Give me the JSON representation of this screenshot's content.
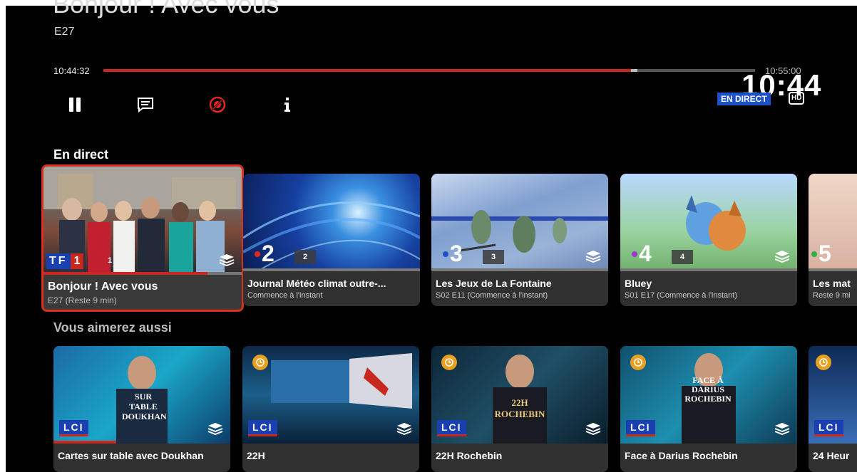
{
  "player": {
    "title": "Bonjour ! Avec vous",
    "episode": "E27",
    "time_start": "10:44:32",
    "time_end": "10:55:00",
    "progress": 0.81,
    "buffered": 0.82,
    "clock": "10:44",
    "live_label": "EN DIRECT",
    "hd_label": "HD",
    "controls": [
      "pause",
      "subtitles",
      "stop-record",
      "info"
    ]
  },
  "sections": {
    "live_title": "En direct",
    "suggest_title": "Vous aimerez aussi"
  },
  "live_cards": [
    {
      "title": "Bonjour ! Avec vous",
      "sub": "E27 (Reste 9 min)",
      "channel": "1",
      "logo": "TF1"
    },
    {
      "title": "Journal Météo climat outre-...",
      "sub": "Commence à l'instant",
      "channel": "2",
      "logo": "2"
    },
    {
      "title": "Les Jeux de La Fontaine",
      "sub": "S02 E11 (Commence à l'instant)",
      "channel": "3",
      "logo": "3"
    },
    {
      "title": "Bluey",
      "sub": "S01 E17 (Commence à l'instant)",
      "channel": "4",
      "logo": "4"
    },
    {
      "title": "Les mat",
      "sub": "Reste 9 mi",
      "channel": "5",
      "logo": "5"
    }
  ],
  "suggest_cards": [
    {
      "title": "Cartes sur table avec Doukhan",
      "logo": "LCI",
      "art": "SUR TABLE DOUKHAN"
    },
    {
      "title": "22H",
      "logo": "LCI"
    },
    {
      "title": "22H Rochebin",
      "logo": "LCI",
      "art": "22H ROCHEBIN"
    },
    {
      "title": "Face à Darius Rochebin",
      "logo": "LCI",
      "art": "FACE À DARIUS ROCHEBIN"
    },
    {
      "title": "24 Heur",
      "logo": "LCI"
    }
  ],
  "colors": {
    "accent": "#c8281e",
    "live_badge": "#1e50c8",
    "card_bg": "#303030"
  }
}
